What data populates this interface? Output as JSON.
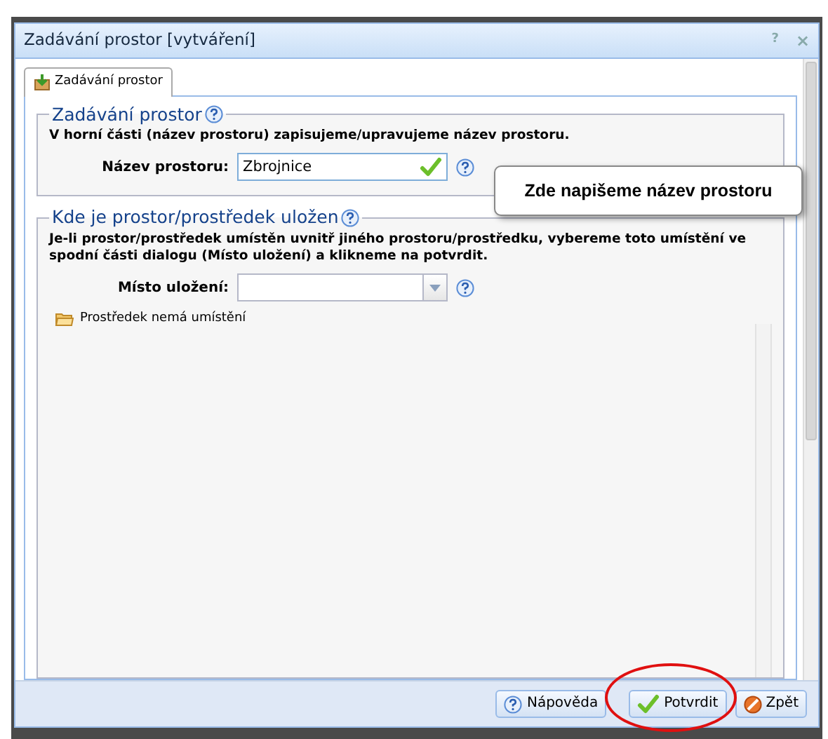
{
  "window": {
    "title": "Zadávání prostor [vytváření]",
    "controls": [
      {
        "kind": "help",
        "label": "?"
      },
      {
        "kind": "close",
        "label": "×"
      }
    ]
  },
  "tabs": [
    {
      "label": "Zadávání prostor",
      "selected": true
    }
  ],
  "sections": [
    {
      "legend": "Zadávání prostor",
      "text": "V horní části (název prostoru) zapisujeme/upravujeme název prostoru.",
      "field": {
        "kind": "text",
        "label": "Název prostoru:",
        "value": "Zbrojnice",
        "valid": true
      }
    },
    {
      "legend": "Kde je prostor/prostředek uložen",
      "text": "Je-li prostor/prostředek umístěn uvnitř jiného prostoru/prostředku, vybereme toto umístění ve spodní části dialogu (Místo uložení) a klikneme na potvrdit.",
      "field": {
        "kind": "combo",
        "label": "Místo uložení:",
        "valid": false
      },
      "tree": [
        {
          "label": "Prostředek nemá umístění"
        }
      ]
    }
  ],
  "callout": {
    "text": "Zde napišeme název prostoru"
  },
  "buttons": [
    {
      "kind": "help",
      "label": "Nápověda",
      "highlighted": false
    },
    {
      "kind": "confirm",
      "label": "Potvrdit",
      "highlighted": true
    },
    {
      "kind": "back",
      "label": "Zpět",
      "highlighted": false
    }
  ]
}
